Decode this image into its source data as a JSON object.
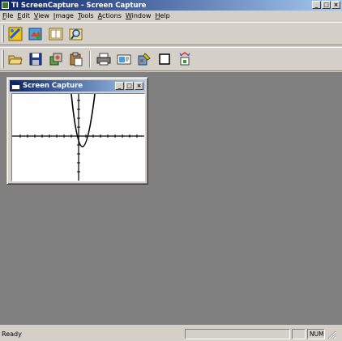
{
  "window": {
    "title": "TI ScreenCapture - Screen Capture",
    "controls": {
      "minimize": "_",
      "restore": "□",
      "close": "×"
    }
  },
  "menu": {
    "items": [
      "File",
      "Edit",
      "View",
      "Image",
      "Tools",
      "Actions",
      "Window",
      "Help"
    ]
  },
  "toolbar1": {
    "buttons": [
      "capture-screen-icon",
      "capture-picture-icon",
      "slideshow-icon",
      "magnifier-icon"
    ]
  },
  "toolbar2": {
    "buttons": [
      "open-folder-icon",
      "save-disk-icon",
      "copy-icon",
      "paste-icon",
      "print-icon",
      "send-icon",
      "paint-icon",
      "border-icon",
      "effects-wand-icon"
    ]
  },
  "child_window": {
    "title": "Screen Capture",
    "controls": {
      "minimize": "_",
      "restore": "□",
      "close": "×"
    }
  },
  "status": {
    "text": "Ready",
    "panel_num": "NUM"
  },
  "colors": {
    "titlebar_start": "#0a246a",
    "titlebar_end": "#a6caf0",
    "face": "#d4d0c8",
    "mdi_background": "#808080"
  }
}
